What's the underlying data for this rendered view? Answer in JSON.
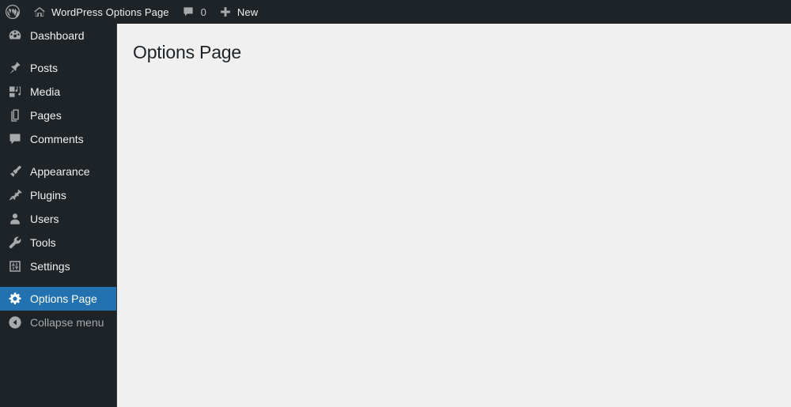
{
  "adminbar": {
    "logo_icon": "wordpress-logo-icon",
    "site_icon": "home-icon",
    "site_name": "WordPress Options Page",
    "comments_icon": "comment-bubble-icon",
    "comments_count": "0",
    "new_icon": "plus-icon",
    "new_label": "New"
  },
  "sidebar": {
    "groups": [
      {
        "items": [
          {
            "label": "Dashboard",
            "icon": "dashboard-gauge-icon",
            "current": false
          }
        ]
      },
      {
        "items": [
          {
            "label": "Posts",
            "icon": "pushpin-icon",
            "current": false
          },
          {
            "label": "Media",
            "icon": "media-icon",
            "current": false
          },
          {
            "label": "Pages",
            "icon": "pages-icon",
            "current": false
          },
          {
            "label": "Comments",
            "icon": "comment-bubble-icon",
            "current": false
          }
        ]
      },
      {
        "items": [
          {
            "label": "Appearance",
            "icon": "paintbrush-icon",
            "current": false
          },
          {
            "label": "Plugins",
            "icon": "plug-icon",
            "current": false
          },
          {
            "label": "Users",
            "icon": "user-icon",
            "current": false
          },
          {
            "label": "Tools",
            "icon": "wrench-icon",
            "current": false
          },
          {
            "label": "Settings",
            "icon": "sliders-icon",
            "current": false
          }
        ]
      },
      {
        "items": [
          {
            "label": "Options Page",
            "icon": "gear-icon",
            "current": true
          }
        ]
      }
    ],
    "collapse": {
      "label": "Collapse menu",
      "icon": "collapse-arrow-icon"
    }
  },
  "content": {
    "page_title": "Options Page"
  },
  "colors": {
    "admin_bar_bg": "#1d2327",
    "sidebar_bg": "#1d2327",
    "accent_blue": "#2271b1",
    "content_bg": "#f0f0f1",
    "icon_gray": "#a7aaad",
    "text_light": "#f0f0f1"
  }
}
